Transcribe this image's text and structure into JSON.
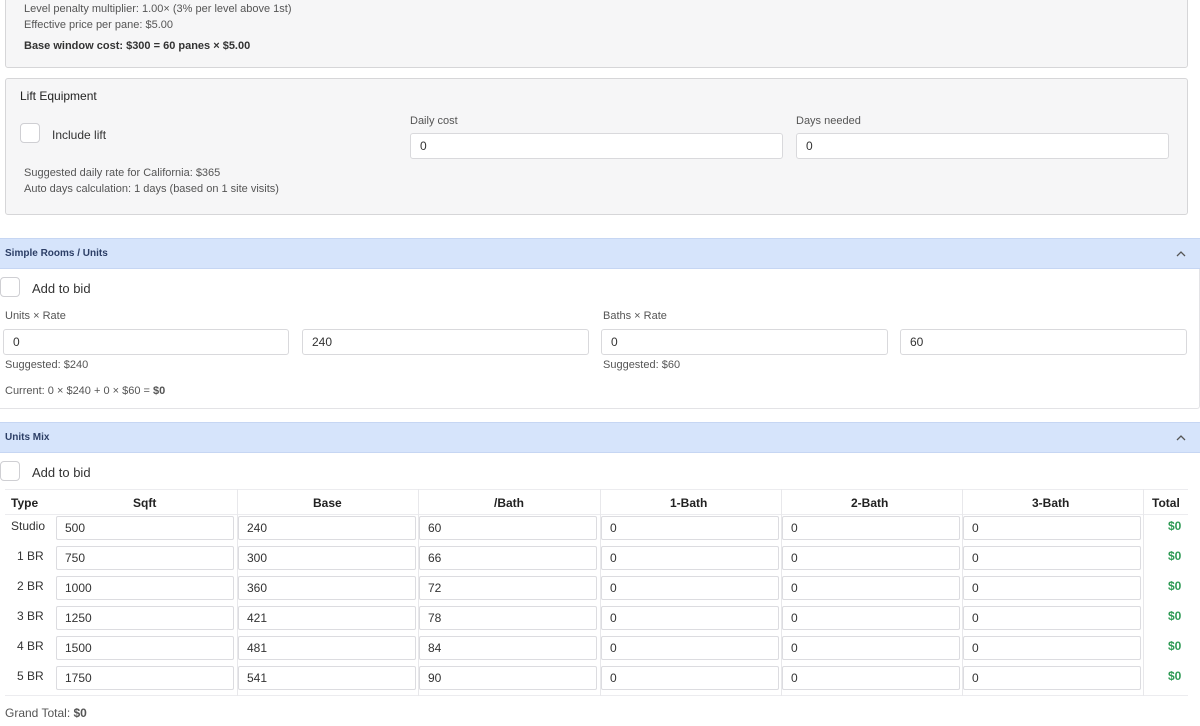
{
  "window_cost": {
    "level_penalty": "Level penalty multiplier: 1.00× (3% per level above 1st)",
    "effective_price": "Effective price per pane: $5.00",
    "base_cost": "Base window cost: $300 = 60 panes × $5.00"
  },
  "lift": {
    "title": "Lift Equipment",
    "include_label": "Include lift",
    "daily_cost_label": "Daily cost",
    "daily_cost_value": "0",
    "days_needed_label": "Days needed",
    "days_needed_value": "0",
    "suggested_rate": "Suggested daily rate for California: $365",
    "auto_days": "Auto days calculation: 1 days (based on 1 site visits)"
  },
  "simple_rooms": {
    "title": "Simple Rooms / Units",
    "add_label": "Add to bid",
    "units_rate_label": "Units × Rate",
    "units_value": "0",
    "unit_rate_value": "240",
    "unit_suggested": "Suggested: $240",
    "baths_rate_label": "Baths × Rate",
    "baths_value": "0",
    "bath_rate_value": "60",
    "bath_suggested": "Suggested: $60",
    "current_prefix": "Current: 0 × $240 + 0 × $60 = ",
    "current_total": "$0"
  },
  "units_mix": {
    "title": "Units Mix",
    "add_label": "Add to bid",
    "headers": [
      "Type",
      "Sqft",
      "Base",
      "/Bath",
      "1-Bath",
      "2-Bath",
      "3-Bath",
      "Total"
    ],
    "rows": [
      {
        "type": "Studio",
        "sqft": "500",
        "base": "240",
        "bath": "60",
        "b1": "0",
        "b2": "0",
        "b3": "0",
        "total": "$0"
      },
      {
        "type": "1 BR",
        "sqft": "750",
        "base": "300",
        "bath": "66",
        "b1": "0",
        "b2": "0",
        "b3": "0",
        "total": "$0"
      },
      {
        "type": "2 BR",
        "sqft": "1000",
        "base": "360",
        "bath": "72",
        "b1": "0",
        "b2": "0",
        "b3": "0",
        "total": "$0"
      },
      {
        "type": "3 BR",
        "sqft": "1250",
        "base": "421",
        "bath": "78",
        "b1": "0",
        "b2": "0",
        "b3": "0",
        "total": "$0"
      },
      {
        "type": "4 BR",
        "sqft": "1500",
        "base": "481",
        "bath": "84",
        "b1": "0",
        "b2": "0",
        "b3": "0",
        "total": "$0"
      },
      {
        "type": "5 BR",
        "sqft": "1750",
        "base": "541",
        "bath": "90",
        "b1": "0",
        "b2": "0",
        "b3": "0",
        "total": "$0"
      }
    ],
    "grand_total_label": "Grand Total: ",
    "grand_total_value": "$0"
  },
  "icons": {
    "collapse": "chevron-up-icon"
  }
}
